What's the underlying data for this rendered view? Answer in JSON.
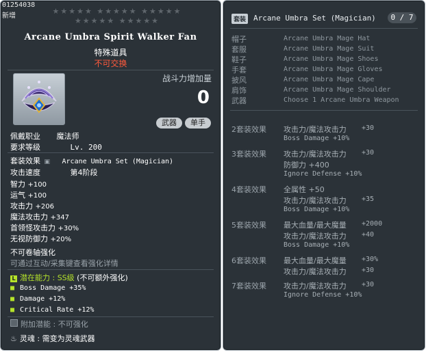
{
  "item": {
    "id": "01254038",
    "new_label": "新增",
    "stars": "★★★★★ ★★★★★ ★★★★★ ★★★★★ ★★★★★",
    "name": "Arcane Umbra Spirit Walker Fan",
    "type": "特殊道具",
    "tradeable": "不可交换",
    "combat_power_label": "战斗力增加量",
    "combat_power_value": "0",
    "tags": [
      "武器",
      "单手"
    ],
    "job_label": "佩戴职业",
    "job_value": "魔法师",
    "level_label": "要求等级",
    "level_value": "Lv. 200",
    "set_label": "套装效果",
    "set_value": "Arcane Umbra Set (Magician)",
    "speed_label": "攻击速度",
    "speed_value": "第4阶段",
    "stats": [
      {
        "label": "智力",
        "value": "+100"
      },
      {
        "label": "运气",
        "value": "+100"
      },
      {
        "label": "攻击力",
        "value": "+206"
      },
      {
        "label": "魔法攻击力",
        "value": "+347"
      },
      {
        "label": "首领怪攻击力",
        "value": "+30%"
      },
      {
        "label": "无视防御力",
        "value": "+20%"
      }
    ],
    "no_scroll": "不可卷轴强化",
    "enhance_hint": "可通过互动/采集键查看强化详情",
    "potential_label": "潜在能力",
    "potential_grade": "SS级",
    "potential_note": "(不可额外强化)",
    "potential_lines": [
      "Boss Damage +35%",
      "Damage +12%",
      "Critical Rate +12%"
    ],
    "additional_label": "附加潜能",
    "additional_value": "不可强化",
    "soul_label": "灵魂",
    "soul_value": "需变为灵魂武器"
  },
  "set": {
    "badge": "套装",
    "title": "Arcane Umbra Set (Magician)",
    "count": "0 / 7",
    "pieces": [
      {
        "cat": "帽子",
        "name": "Arcane Umbra Mage Hat"
      },
      {
        "cat": "套服",
        "name": "Arcane Umbra Mage Suit"
      },
      {
        "cat": "鞋子",
        "name": "Arcane Umbra Mage Shoes"
      },
      {
        "cat": "手套",
        "name": "Arcane Umbra Mage Gloves"
      },
      {
        "cat": "披风",
        "name": "Arcane Umbra Mage Cape"
      },
      {
        "cat": "肩饰",
        "name": "Arcane Umbra Mage Shoulder"
      },
      {
        "cat": "武器",
        "name": "Choose 1 Arcane Umbra Weapon"
      }
    ],
    "bonuses": [
      {
        "head": "2套装效果",
        "lines": [
          {
            "l": "攻击力/魔法攻击力",
            "v": "+30"
          },
          {
            "l": "Boss Damage +10%",
            "v": ""
          }
        ]
      },
      {
        "head": "3套装效果",
        "lines": [
          {
            "l": "攻击力/魔法攻击力",
            "v": "+30"
          },
          {
            "l": "防御力   +400",
            "v": ""
          },
          {
            "l": "Ignore Defense +10%",
            "v": ""
          }
        ]
      },
      {
        "head": "4套装效果",
        "lines": [
          {
            "l": "全属性   +50",
            "v": ""
          },
          {
            "l": "攻击力/魔法攻击力",
            "v": "+35"
          },
          {
            "l": "Boss Damage +10%",
            "v": ""
          }
        ]
      },
      {
        "head": "5套装效果",
        "lines": [
          {
            "l": "最大血量/最大魔量",
            "v": "+2000"
          },
          {
            "l": "攻击力/魔法攻击力",
            "v": "+40"
          },
          {
            "l": "Boss Damage +10%",
            "v": ""
          }
        ]
      },
      {
        "head": "6套装效果",
        "lines": [
          {
            "l": "最大血量/最大魔量",
            "v": "+30%"
          },
          {
            "l": "攻击力/魔法攻击力",
            "v": "+30"
          }
        ]
      },
      {
        "head": "7套装效果",
        "lines": [
          {
            "l": "攻击力/魔法攻击力",
            "v": "+30"
          },
          {
            "l": "Ignore Defense +10%",
            "v": ""
          }
        ]
      }
    ]
  },
  "colors": {
    "panel_bg": "#2b3238",
    "untradeable": "#ff5a3c",
    "potential": "#b5e32a",
    "muted": "#9aa3aa"
  }
}
